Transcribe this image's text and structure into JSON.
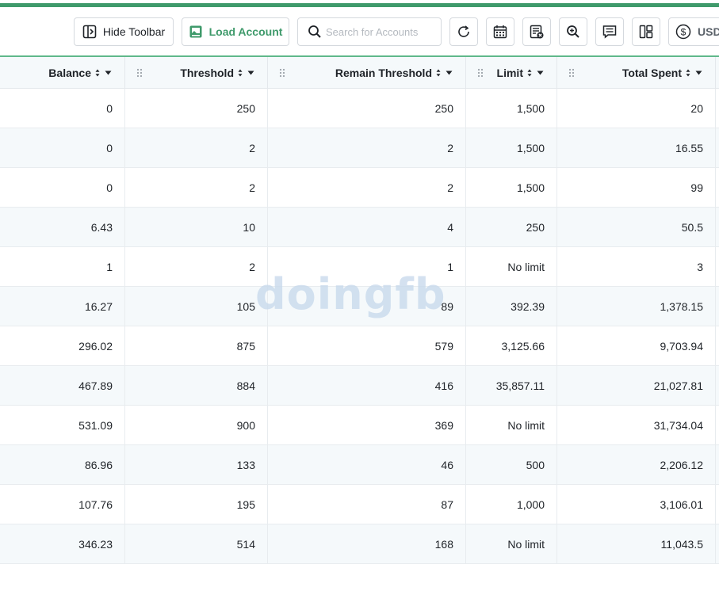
{
  "toolbar": {
    "hide_toolbar_label": "Hide Toolbar",
    "load_account_label": "Load Account",
    "search_placeholder": "Search for Accounts",
    "currency_label": "USD",
    "accent_color": "#3f9a6b"
  },
  "table": {
    "columns": [
      "Balance",
      "Threshold",
      "Remain Threshold",
      "Limit",
      "Total Spent"
    ],
    "rows": [
      [
        "0",
        "250",
        "250",
        "1,500",
        "20"
      ],
      [
        "0",
        "2",
        "2",
        "1,500",
        "16.55"
      ],
      [
        "0",
        "2",
        "2",
        "1,500",
        "99"
      ],
      [
        "6.43",
        "10",
        "4",
        "250",
        "50.5"
      ],
      [
        "1",
        "2",
        "1",
        "No limit",
        "3"
      ],
      [
        "16.27",
        "105",
        "89",
        "392.39",
        "1,378.15"
      ],
      [
        "296.02",
        "875",
        "579",
        "3,125.66",
        "9,703.94"
      ],
      [
        "467.89",
        "884",
        "416",
        "35,857.11",
        "21,027.81"
      ],
      [
        "531.09",
        "900",
        "369",
        "No limit",
        "31,734.04"
      ],
      [
        "86.96",
        "133",
        "46",
        "500",
        "2,206.12"
      ],
      [
        "107.76",
        "195",
        "87",
        "1,000",
        "3,106.01"
      ],
      [
        "346.23",
        "514",
        "168",
        "No limit",
        "11,043.5"
      ]
    ]
  },
  "watermark": "doingfb"
}
